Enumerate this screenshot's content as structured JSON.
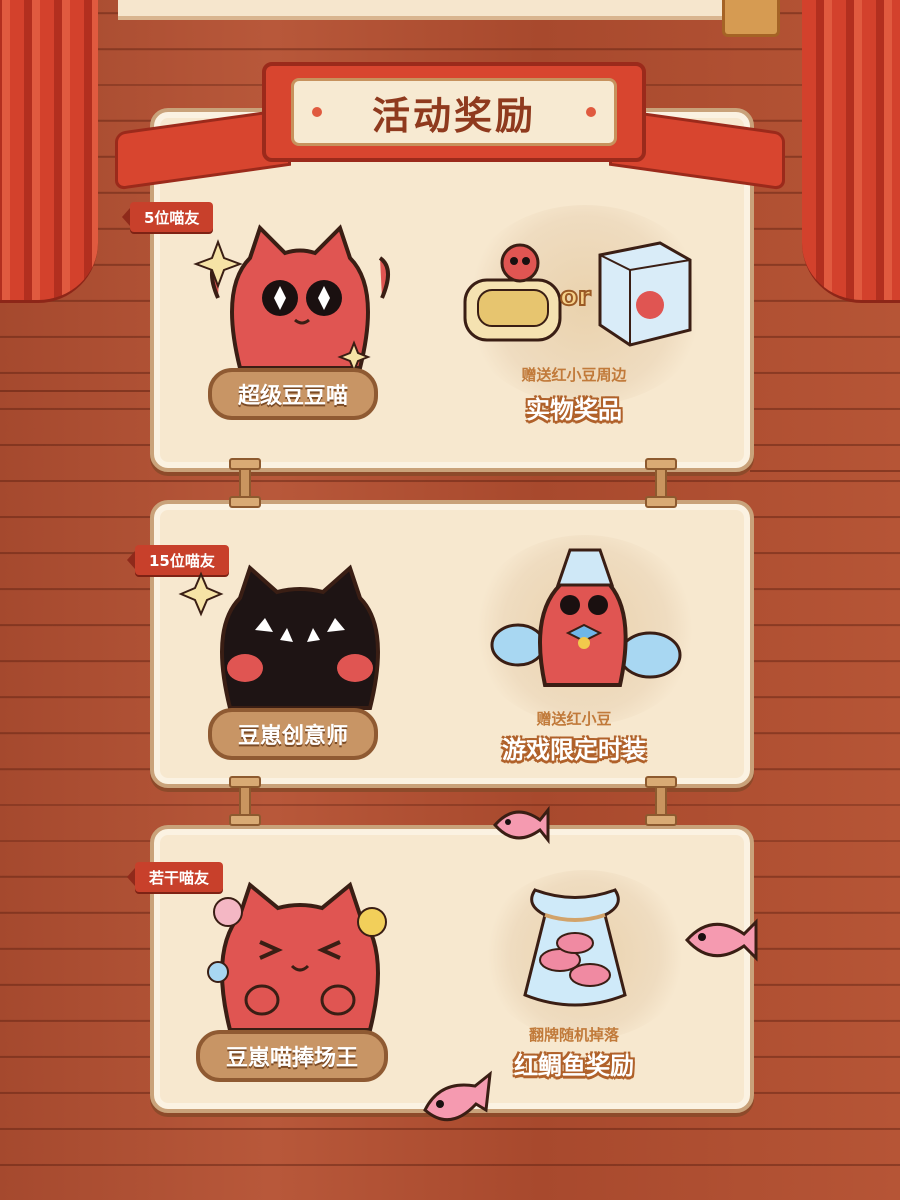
{
  "title": "活动奖励",
  "colors": {
    "accent_red": "#c8402b",
    "panel": "#f7e8cf",
    "label_brown": "#c89565",
    "reward_orange": "#b0612a"
  },
  "tiers": [
    {
      "badge": "5位喵友",
      "character_label": "超级豆豆喵",
      "reward_sub": "赠送红小豆周边",
      "reward_main": "实物奖品",
      "or_text": "or"
    },
    {
      "badge": "15位喵友",
      "character_label": "豆崽创意师",
      "reward_sub": "赠送红小豆",
      "reward_main": "游戏限定时装"
    },
    {
      "badge": "若干喵友",
      "character_label": "豆崽喵捧场王",
      "reward_sub": "翻牌随机掉落",
      "reward_main": "红鲷鱼奖励"
    }
  ]
}
